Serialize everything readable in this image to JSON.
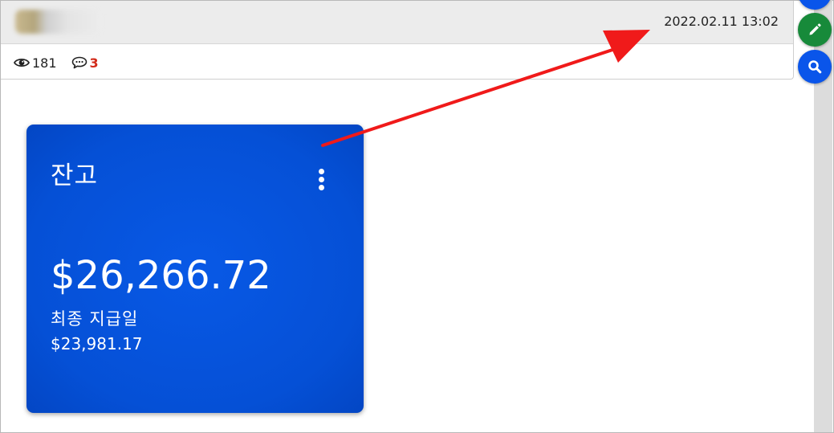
{
  "post": {
    "date": "2022.02.11 13:02",
    "views": "181",
    "comments": "3"
  },
  "card": {
    "title": "잔고",
    "amount": "$26,266.72",
    "sub_label": "최종 지급일",
    "sub_amount": "$23,981.17"
  },
  "colors": {
    "card_blue": "#0552d8",
    "fab_blue": "#0a55ea",
    "fab_green": "#178a3a",
    "comment_red": "#d22a1a",
    "arrow_red": "#f01a1a"
  },
  "icons": {
    "views": "eye-icon",
    "comments": "speech-bubble-icon",
    "edit": "pencil-icon",
    "search": "search-icon",
    "more": "more-vertical-icon"
  }
}
